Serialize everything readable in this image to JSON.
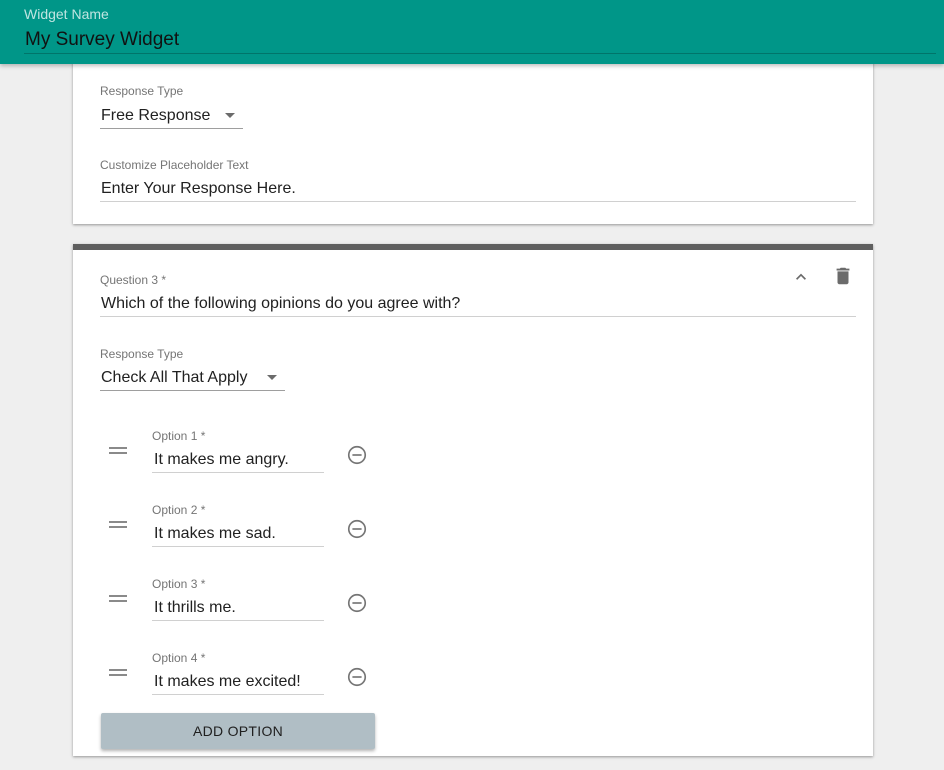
{
  "header": {
    "label": "Widget Name",
    "value": "My Survey Widget"
  },
  "question2": {
    "response_type_label": "Response Type",
    "response_type_value": "Free Response",
    "placeholder_label": "Customize Placeholder Text",
    "placeholder_value": "Enter Your Response Here."
  },
  "question3": {
    "label": "Question 3 *",
    "value": "Which of the following opinions do you agree with?",
    "response_type_label": "Response Type",
    "response_type_value": "Check All That Apply",
    "options": [
      {
        "label": "Option 1 *",
        "value": "It makes me angry."
      },
      {
        "label": "Option 2 *",
        "value": "It makes me sad."
      },
      {
        "label": "Option 3 *",
        "value": "It thrills me."
      },
      {
        "label": "Option 4 *",
        "value": "It makes me excited!"
      }
    ],
    "add_option_label": "ADD OPTION"
  },
  "icons": {
    "collapse": "chevron-up-icon",
    "delete": "trash-icon",
    "drag": "drag-handle-icon",
    "remove": "minus-circle-icon"
  },
  "colors": {
    "header_bg": "#009688",
    "card_accent": "#5f5f5f",
    "add_button_bg": "#b0bec5"
  }
}
